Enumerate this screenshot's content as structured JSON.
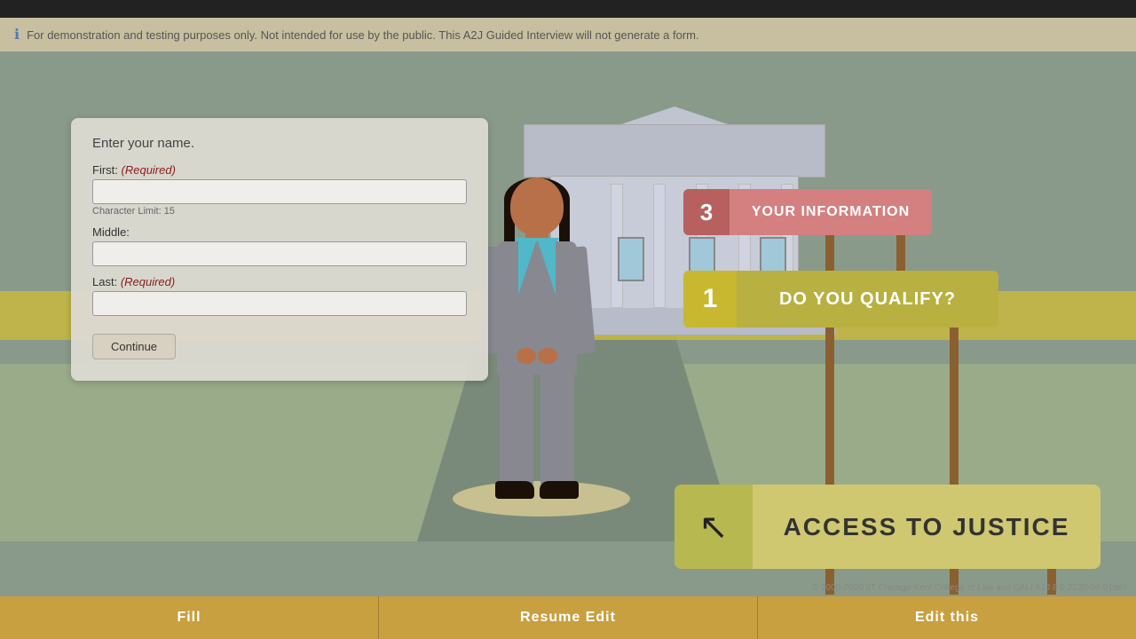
{
  "infoBar": {
    "icon": "ℹ",
    "text": "For demonstration and testing purposes only. Not intended for use by the public. This A2J Guided Interview will not generate a form."
  },
  "form": {
    "prompt": "Enter your name.",
    "firstLabel": "First:",
    "firstRequired": "(Required)",
    "charLimit": "Character Limit: 15",
    "middleLabel": "Middle:",
    "lastLabel": "Last:",
    "lastRequired": "(Required)",
    "continueBtn": "Continue"
  },
  "signs": {
    "yourInfo": {
      "number": "3",
      "text": "YOUR INFORMATION"
    },
    "qualify": {
      "number": "1",
      "text": "DO YOU QUALIFY?"
    },
    "access": {
      "iconUnicode": "↖",
      "text": "ACCESS TO JUSTICE"
    }
  },
  "toolbar": {
    "fillLabel": "Fill",
    "resumeEditLabel": "Resume Edit",
    "editLabel": "Edit this"
  },
  "copyright": "© 2000-2020 IIT Chicago-Kent College of Law and CALI A2J 8.0.2220-04-01dev"
}
